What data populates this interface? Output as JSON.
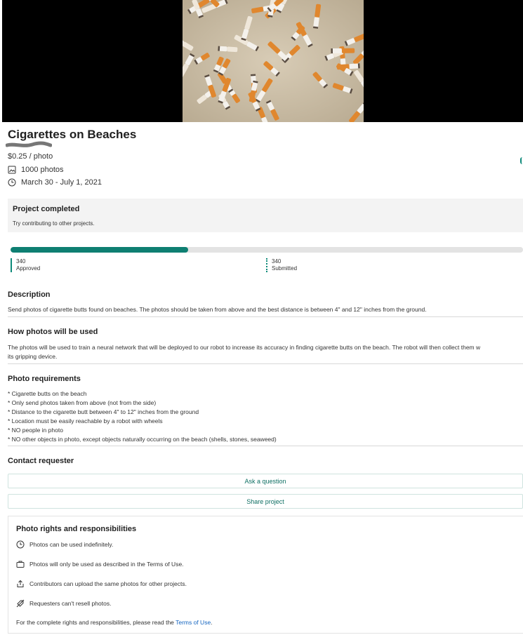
{
  "project": {
    "title": "Cigarettes on Beaches",
    "price": "$0.25 / photo",
    "photo_count": "1000 photos",
    "dates": "March 30 - July 1, 2021"
  },
  "status": {
    "title": "Project completed",
    "subtitle": "Try contributing to other projects."
  },
  "progress": {
    "fraction": 0.347,
    "approved_count": "340",
    "approved_label": "Approved",
    "submitted_count": "340",
    "submitted_label": "Submitted"
  },
  "description": {
    "heading": "Description",
    "text": "Send photos of cigarette butts found on beaches. The photos should be taken from above and the best distance is between 4\" and 12\" inches from the ground."
  },
  "usage": {
    "heading": "How photos will be used",
    "line1": "The photos will be used to train a neural network that will be deployed to our robot to increase its accuracy in finding cigarette butts on the beach. The robot will then collect them w",
    "line2": "its gripping device."
  },
  "requirements": {
    "heading": "Photo requirements",
    "items": [
      "* Cigarette butts on the beach",
      "* Only send photos taken from above (not from the side)",
      "* Distance to the cigarette butt between 4\" to 12\" inches from the ground",
      "* Location must be easily reachable by a robot with wheels",
      "* NO people in photo",
      "* NO other objects in photo, except objects naturally occurring on the beach (shells, stones, seaweed)"
    ]
  },
  "contact": {
    "heading": "Contact requester",
    "ask_label": "Ask a question",
    "share_label": "Share project"
  },
  "rights": {
    "heading": "Photo rights and responsibilities",
    "items": [
      {
        "icon": "clock-icon",
        "text": "Photos can be used indefinitely."
      },
      {
        "icon": "briefcase-icon",
        "text": "Photos will only be used as described in the Terms of Use."
      },
      {
        "icon": "share-icon",
        "text": "Contributors can upload the same photos for other projects."
      },
      {
        "icon": "no-resell-icon",
        "text": "Requesters can't resell photos."
      }
    ],
    "footer_text": "For the complete rights and responsibilities, please read the ",
    "footer_link": "Terms of Use",
    "footer_end": "."
  },
  "colors": {
    "accent": "#0e7f72",
    "link": "#1565c0",
    "status_bg": "#f3f3f3",
    "track": "#e3e3e3"
  }
}
